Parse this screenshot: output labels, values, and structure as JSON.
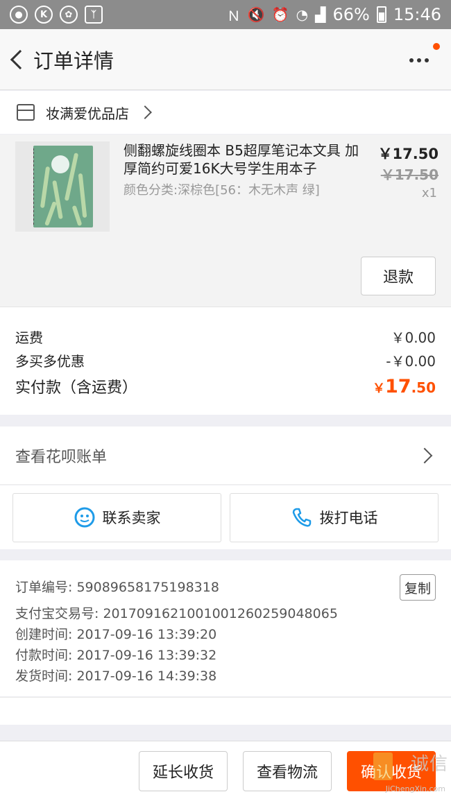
{
  "status_bar": {
    "battery": "66%",
    "time": "15:46",
    "left_icons": [
      "app-badge-icon",
      "k-icon",
      "flower-icon",
      "runner-icon"
    ],
    "right_icons": [
      "nfc-icon",
      "mute-icon",
      "alarm-icon",
      "wifi-icon",
      "signal-icon",
      "battery-icon"
    ]
  },
  "header": {
    "title": "订单详情"
  },
  "shop": {
    "name": "妆满爱优品店"
  },
  "product": {
    "title": "侧翻螺旋线圈本 B5超厚笔记本文具 加厚简约可爱16K大号学生用本子",
    "spec": "颜色分类:深棕色[56：木无木声 绿]",
    "price": "￥17.50",
    "original_price": "￥17.50",
    "quantity": "x1",
    "refund_label": "退款"
  },
  "costs": {
    "shipping_label": "运费",
    "shipping_value": "￥0.00",
    "discount_label": "多买多优惠",
    "discount_value": "-￥0.00",
    "total_label": "实付款（含运费）",
    "total_currency": "￥",
    "total_int": "17",
    "total_dec": ".50"
  },
  "huabei": {
    "label": "查看花呗账单"
  },
  "contacts": {
    "seller_label": "联系卖家",
    "phone_label": "拨打电话"
  },
  "order_info": {
    "order_no": "订单编号: 59089658175198318",
    "alipay_no": "支付宝交易号: 2017091621001001260259048065",
    "created": "创建时间: 2017-09-16 13:39:20",
    "paid": "付款时间: 2017-09-16 13:39:32",
    "shipped": "发货时间: 2017-09-16 14:39:38",
    "copy_label": "复制"
  },
  "bottom": {
    "extend_label": "延长收货",
    "logistics_label": "查看物流",
    "confirm_label": "确认收货"
  },
  "watermark": {
    "text": "诚信",
    "url": "JiChengXin.com"
  },
  "colors": {
    "accent": "#ff5000",
    "status_bar": "#8c8c8c",
    "contact_blue": "#1e9be8"
  }
}
